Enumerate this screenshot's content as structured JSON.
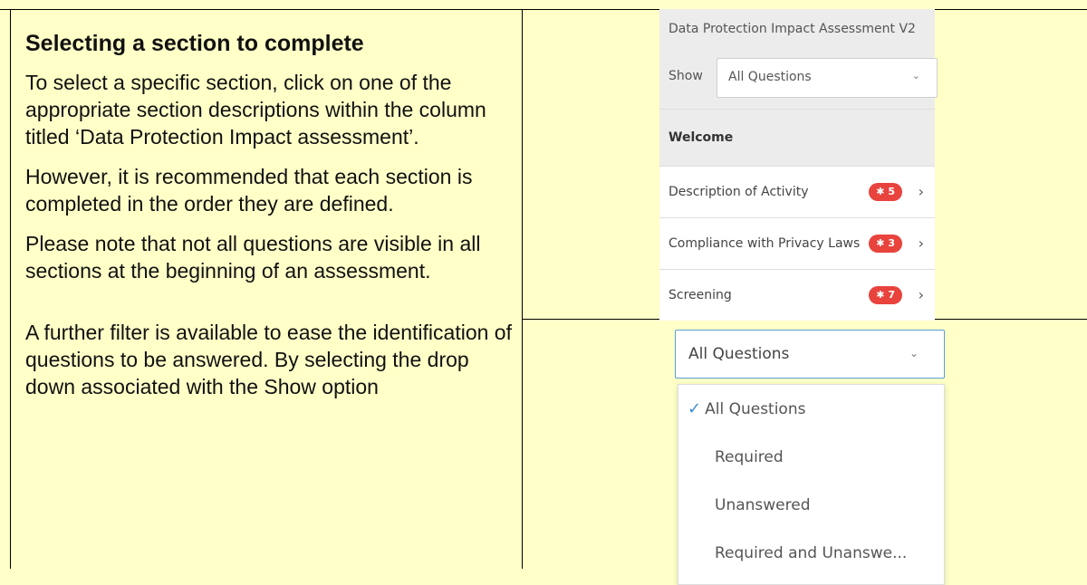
{
  "left": {
    "heading": "Selecting a section to complete",
    "paragraphs": [
      "To select a specific section, click on one of the appropriate section descriptions within the column titled ‘Data Protection Impact assessment’.",
      "However, it is recommended that each section is completed in the order they are defined.",
      "Please note that not all questions are visible in all sections at the beginning of an assessment.",
      "A further filter is available to ease the identification of questions to be answered. By selecting the drop down associated with the Show option"
    ]
  },
  "panel": {
    "title": "Data Protection Impact Assessment V2",
    "show_label": "Show",
    "show_value": "All Questions",
    "welcome": "Welcome",
    "sections": [
      {
        "label": "Description of Activity",
        "badge": "✱ 5"
      },
      {
        "label": "Compliance with Privacy Laws",
        "badge": "✱ 3"
      },
      {
        "label": "Screening",
        "badge": "✱ 7"
      }
    ]
  },
  "dropdown": {
    "value": "All Questions",
    "options": [
      "All Questions",
      "Required",
      "Unanswered",
      "Required and Unanswe..."
    ],
    "selected_index": 0
  },
  "colors": {
    "background": "#ffffc8",
    "badge": "#e8433d",
    "accent": "#3d8fd6"
  }
}
